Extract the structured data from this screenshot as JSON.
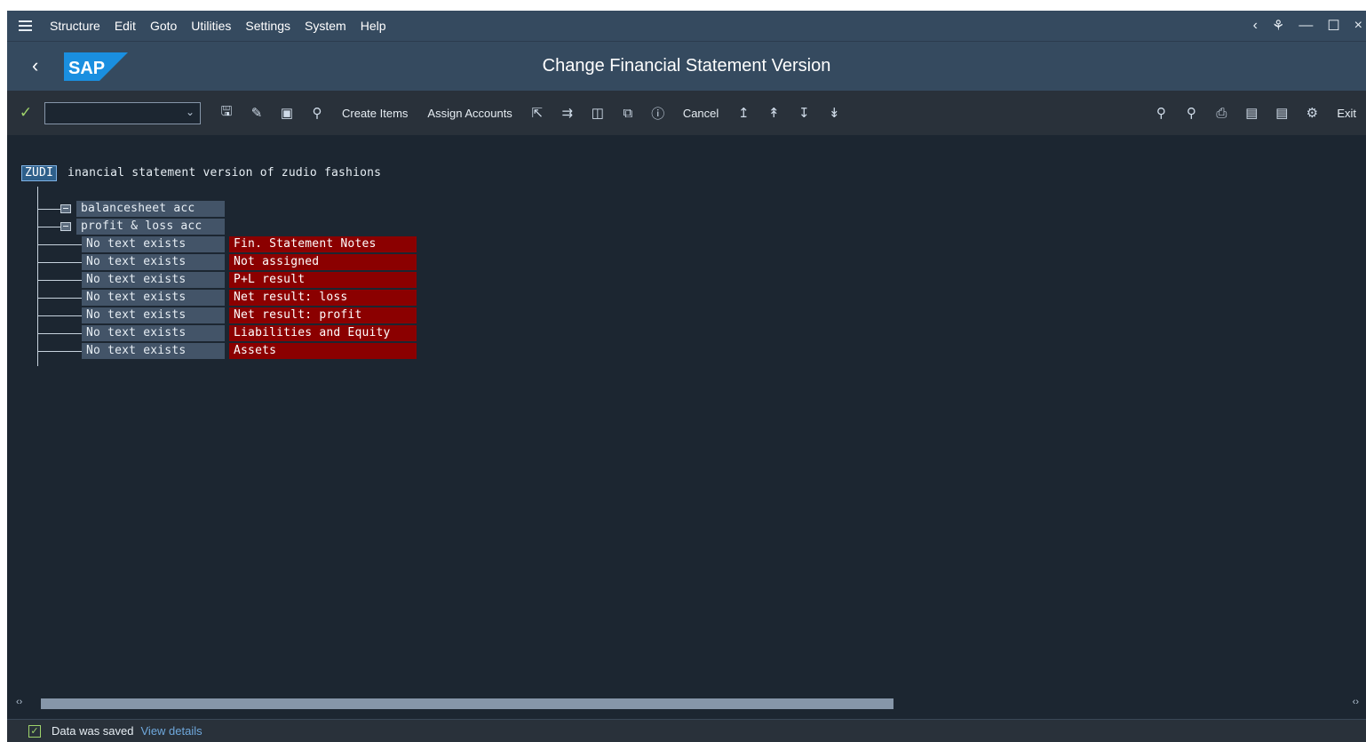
{
  "menubar": {
    "items": [
      "Structure",
      "Edit",
      "Goto",
      "Utilities",
      "Settings",
      "System",
      "Help"
    ]
  },
  "titlebar": {
    "logo_text": "SAP",
    "title": "Change Financial Statement Version"
  },
  "toolbar": {
    "create_items": "Create Items",
    "assign_accounts": "Assign Accounts",
    "cancel": "Cancel",
    "exit": "Exit"
  },
  "tree": {
    "root_code": "ZUDI",
    "root_text": "inancial statement version of zudio fashions",
    "nodes": [
      "balancesheet acc",
      "profit & loss acc"
    ],
    "children": [
      {
        "text": "No text exists",
        "label": "Fin. Statement Notes"
      },
      {
        "text": "No text exists",
        "label": "Not assigned"
      },
      {
        "text": "No text exists",
        "label": "P+L result"
      },
      {
        "text": "No text exists",
        "label": "Net result: loss"
      },
      {
        "text": "No text exists",
        "label": "Net result: profit"
      },
      {
        "text": "No text exists",
        "label": "Liabilities and Equity"
      },
      {
        "text": "No text exists",
        "label": "Assets"
      }
    ]
  },
  "statusbar": {
    "message": "Data was saved",
    "link": "View details"
  },
  "colors": {
    "shell": "#354a5f",
    "canvas": "#1c2631",
    "node_bg": "#435468",
    "highlight_red": "#8b0000",
    "success": "#9fd36b"
  }
}
